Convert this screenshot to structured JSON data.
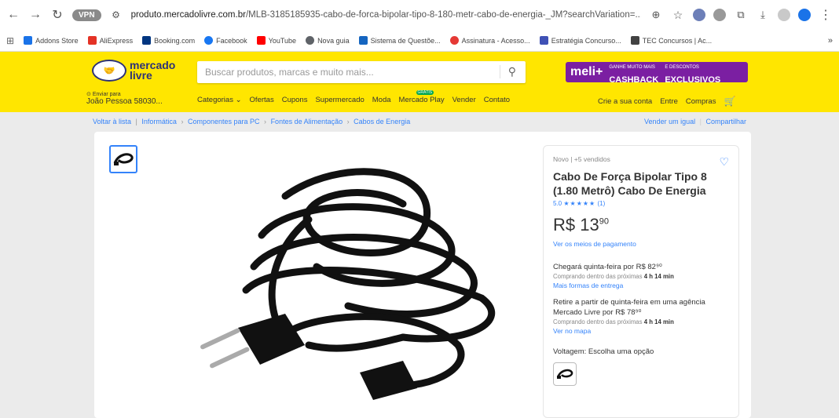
{
  "browser": {
    "url_host": "produto.mercadolivre.com.br",
    "url_path": "/MLB-3185185935-cabo-de-forca-bipolar-tipo-8-180-metr-cabo-de-energia-_JM?searchVariation=...",
    "vpn_label": "VPN"
  },
  "bookmarks": [
    {
      "label": "Addons Store",
      "color": "#1a73e8"
    },
    {
      "label": "AliExpress",
      "color": "#e43225"
    },
    {
      "label": "Booking.com",
      "color": "#003580"
    },
    {
      "label": "Facebook",
      "color": "#1877f2"
    },
    {
      "label": "YouTube",
      "color": "#ff0000"
    },
    {
      "label": "Nova guia",
      "color": "#5f6368"
    },
    {
      "label": "Sistema de Questõe...",
      "color": "#1565c0"
    },
    {
      "label": "Assinatura - Acesso...",
      "color": "#e53935"
    },
    {
      "label": "Estratégia Concurso...",
      "color": "#3f51b5"
    },
    {
      "label": "TEC Concursos | Ac...",
      "color": "#424242"
    }
  ],
  "header": {
    "logo_line1": "mercado",
    "logo_line2": "livre",
    "search_placeholder": "Buscar produtos, marcas e muito mais...",
    "promo_brand": "meli+",
    "promo_small1": "GANHE MUITO MAIS",
    "promo_big1": "CASHBACK",
    "promo_small2": "E DESCONTOS",
    "promo_big2": "EXCLUSIVOS",
    "ship_label": "Enviar para",
    "ship_addr": "João Pessoa 58030...",
    "nav": [
      "Categorias ⌄",
      "Ofertas",
      "Cupons",
      "Supermercado",
      "Moda",
      "Mercado Play",
      "Vender",
      "Contato"
    ],
    "nav_badge": "GRÁTIS",
    "user_nav": [
      "Crie a sua conta",
      "Entre",
      "Compras"
    ]
  },
  "breadcrumb": {
    "back": "Voltar à lista",
    "items": [
      "Informática",
      "Componentes para PC",
      "Fontes de Alimentação",
      "Cabos de Energia"
    ],
    "sell": "Vender um igual",
    "share": "Compartilhar"
  },
  "product": {
    "condition": "Novo  |  +5 vendidos",
    "title": "Cabo De Força Bipolar Tipo 8 (1.80 Metrô) Cabo De Energia",
    "rating_value": "5.0",
    "stars": "★★★★★",
    "rating_count": "(1)",
    "price_main": "R$ 13",
    "price_cents": "90",
    "payment_link": "Ver os meios de pagamento",
    "delivery": "Chegará quinta-feira por R$ 82⁹⁰",
    "delivery_note": "Comprando dentro das próximas",
    "delivery_time": "4 h 14 min",
    "delivery_link": "Mais formas de entrega",
    "pickup": "Retire a partir de quinta-feira em uma agência Mercado Livre por R$ 78⁹⁰",
    "pickup_note": "Comprando dentro das próximas",
    "pickup_time": "4 h 14 min",
    "pickup_link": "Ver no mapa",
    "variation_label": "Voltagem: Escolha uma opção"
  }
}
